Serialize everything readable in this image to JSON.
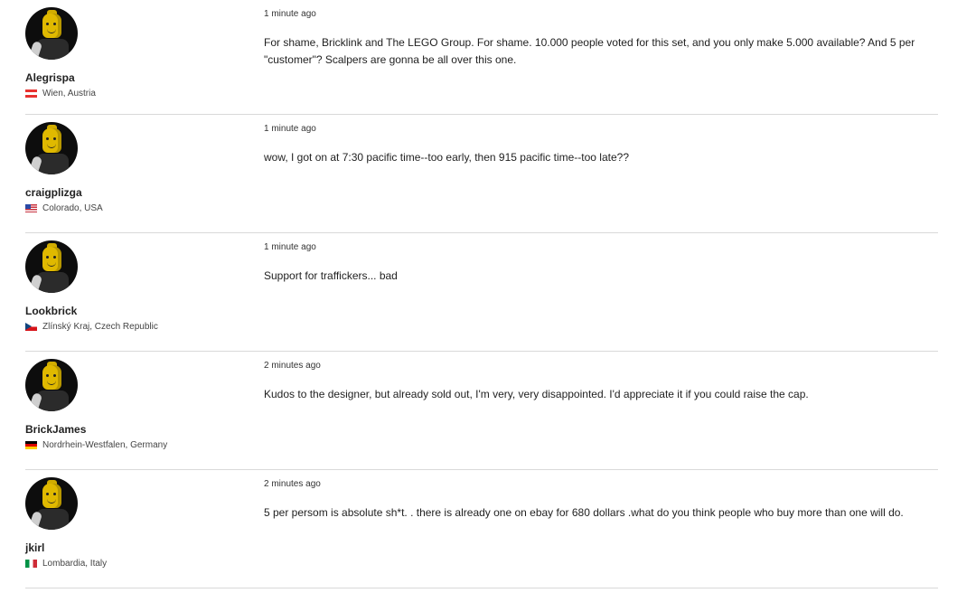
{
  "comments": [
    {
      "username": "Alegrispa",
      "location": "Wien, Austria",
      "flag": "flag-austria",
      "time": "1 minute ago",
      "text": "For shame, Bricklink and The LEGO Group. For shame. 10.000 people voted for this set, and you only make 5.000 available? And 5 per \"customer\"? Scalpers are gonna be all over this one."
    },
    {
      "username": "craigplizga",
      "location": "Colorado, USA",
      "flag": "flag-usa",
      "time": "1 minute ago",
      "text": "wow, I got on at 7:30 pacific time--too early, then 915 pacific time--too late??"
    },
    {
      "username": "Lookbrick",
      "location": "Zlínský Kraj, Czech Republic",
      "flag": "flag-czech-republic",
      "time": "1 minute ago",
      "text": "Support for traffickers... bad"
    },
    {
      "username": "BrickJames",
      "location": "Nordrhein-Westfalen, Germany",
      "flag": "flag-germany",
      "time": "2 minutes ago",
      "text": "Kudos to the designer, but already sold out, I'm very, very disappointed. I'd appreciate it if you could raise the cap."
    },
    {
      "username": "jkirl",
      "location": "Lombardia, Italy",
      "flag": "flag-italy",
      "time": "2 minutes ago",
      "text": "5 per persom is absolute sh*t. . there is already one on ebay for 680 dollars .what do you think people who buy more than one will do."
    }
  ]
}
